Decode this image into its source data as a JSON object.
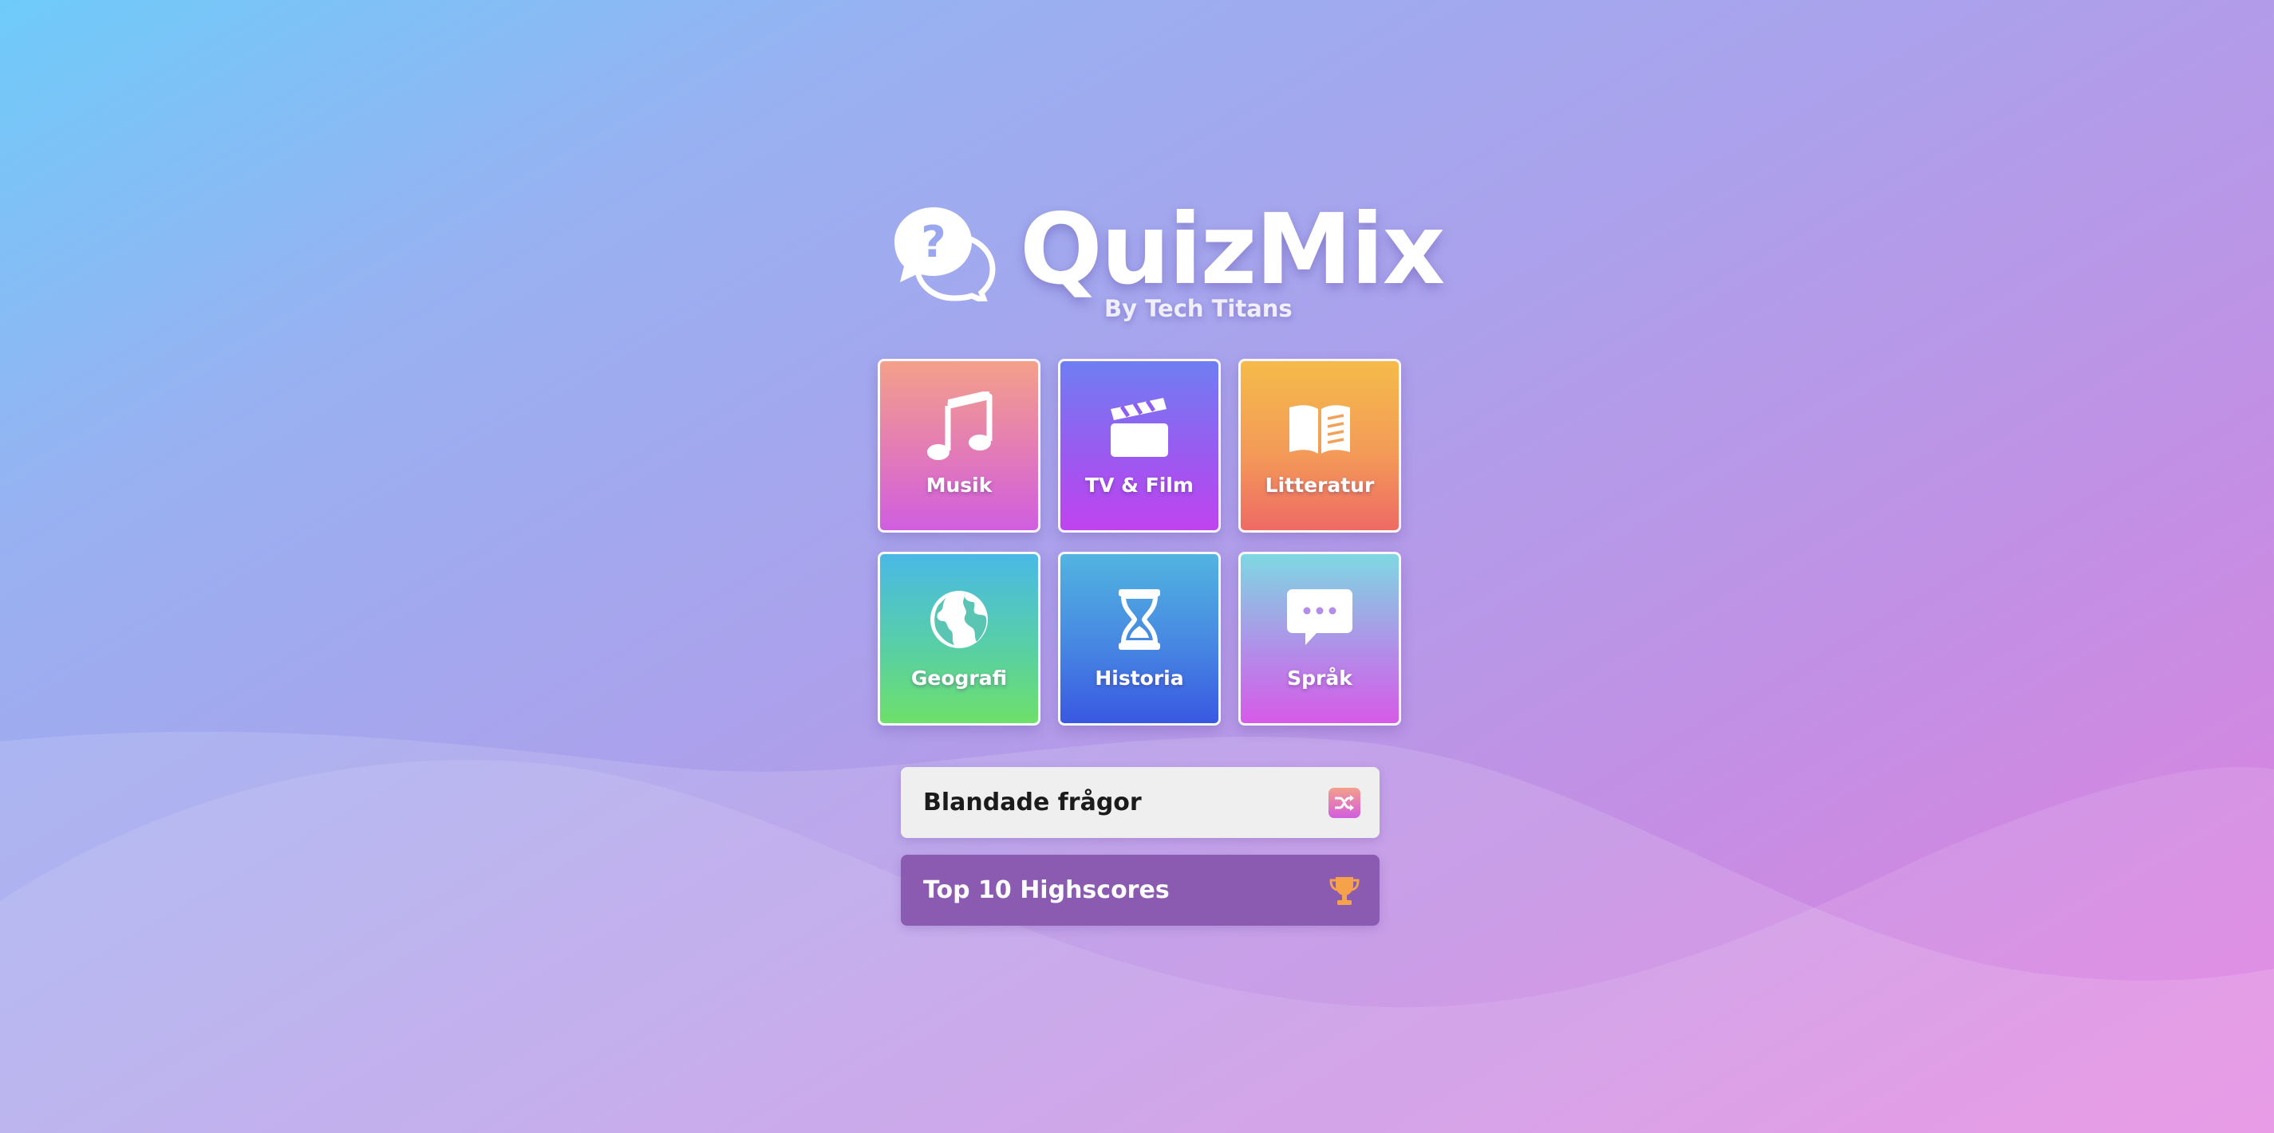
{
  "app": {
    "title": "QuizMix",
    "subtitle": "By Tech Titans"
  },
  "categories": [
    {
      "label": "Musik",
      "icon": "music-note-icon"
    },
    {
      "label": "TV & Film",
      "icon": "clapperboard-icon"
    },
    {
      "label": "Litteratur",
      "icon": "open-book-icon"
    },
    {
      "label": "Geografi",
      "icon": "globe-icon"
    },
    {
      "label": "Historia",
      "icon": "hourglass-icon"
    },
    {
      "label": "Språk",
      "icon": "speech-bubble-icon"
    }
  ],
  "actions": {
    "mixed_label": "Blandade frågor",
    "mixed_icon": "shuffle-icon",
    "highscores_label": "Top 10 Highscores",
    "highscores_icon": "trophy-icon"
  },
  "colors": {
    "background_start": "#6ecbfa",
    "background_end": "#e480e0",
    "highscores_button": "#8b5bb2",
    "mixed_button": "#efefef"
  }
}
